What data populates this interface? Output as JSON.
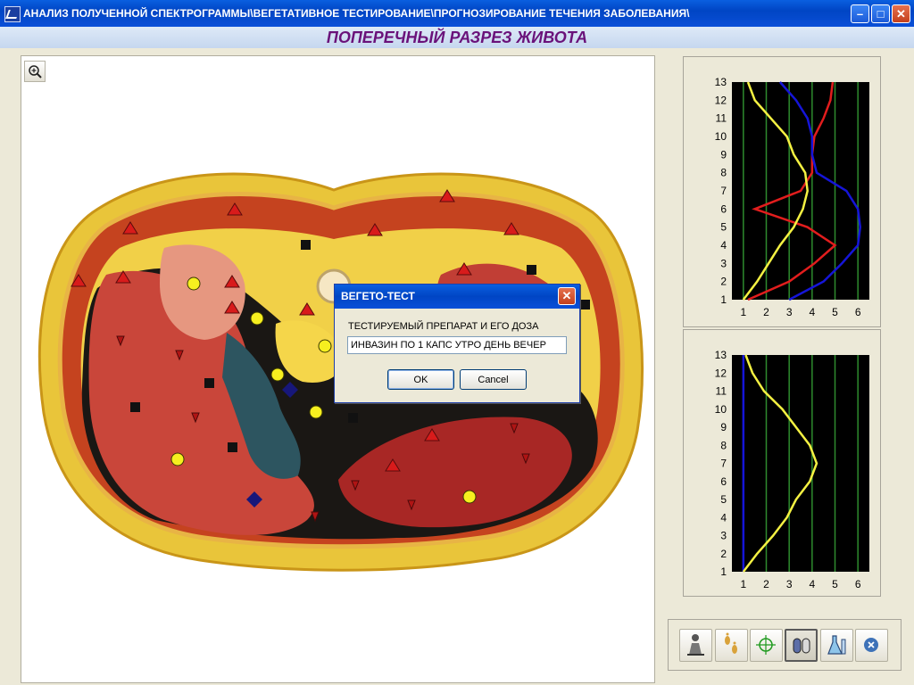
{
  "window": {
    "title": "АНАЛИЗ ПОЛУЧЕННОЙ СПЕКТРОГРАММЫ\\ВЕГЕТАТИВНОЕ ТЕСТИРОВАНИЕ\\ПРОГНОЗИРОВАНИЕ ТЕЧЕНИЯ ЗАБОЛЕВАНИЯ\\",
    "minimize_label": "–",
    "maximize_label": "□",
    "close_label": "✕"
  },
  "header": {
    "title": "ПОПЕРЕЧНЫЙ РАЗРЕЗ ЖИВОТА"
  },
  "main": {
    "zoom_icon": "zoom-in-icon"
  },
  "dialog": {
    "title": "ВЕГЕТО-ТЕСТ",
    "close_label": "✕",
    "prompt": "ТЕСТИРУЕМЫЙ ПРЕПАРАТ И ЕГО ДОЗА",
    "input_value": "ИНВАЗИН ПО 1 КАПС УТРО ДЕНЬ ВЕЧЕР",
    "ok_label": "OK",
    "cancel_label": "Cancel"
  },
  "toolbar": {
    "icons": [
      "patient-icon",
      "footprints-icon",
      "target-icon",
      "capsule-icon",
      "flask-icon",
      "close-circle-icon"
    ],
    "active_index": 3
  },
  "colors": {
    "plot_bg": "#000000",
    "grid": "#2e8b2e",
    "series_red": "#e21d1d",
    "series_blue": "#1515d8",
    "series_yellow": "#f4f142",
    "title_purple": "#6a127a"
  },
  "chart_data": [
    {
      "type": "line",
      "orientation": "vertical",
      "x_ticks": [
        1,
        2,
        3,
        4,
        5,
        6
      ],
      "y_ticks": [
        1,
        2,
        3,
        4,
        5,
        6,
        7,
        8,
        9,
        10,
        11,
        12,
        13
      ],
      "xlim": [
        0.5,
        6.5
      ],
      "ylim": [
        1,
        13
      ],
      "series": [
        {
          "color": "#e21d1d",
          "x": [
            1.2,
            3.0,
            4.1,
            5.0,
            3.8,
            1.5,
            3.5,
            4.0,
            4.0,
            4.1,
            4.5,
            4.8,
            4.9
          ],
          "y": [
            1,
            2,
            3,
            4,
            5,
            6,
            7,
            8,
            9,
            10,
            11,
            12,
            13
          ]
        },
        {
          "color": "#1515d8",
          "x": [
            3.0,
            4.5,
            5.3,
            6.0,
            6.1,
            6.0,
            5.5,
            4.2,
            4.0,
            4.0,
            3.8,
            3.3,
            2.6
          ],
          "y": [
            1,
            2,
            3,
            4,
            5,
            6,
            7,
            8,
            9,
            10,
            11,
            12,
            13
          ]
        },
        {
          "color": "#f4f142",
          "x": [
            1.0,
            1.6,
            2.1,
            2.6,
            3.2,
            3.6,
            3.8,
            3.7,
            3.2,
            2.9,
            2.2,
            1.5,
            1.2
          ],
          "y": [
            1,
            2,
            3,
            4,
            5,
            6,
            7,
            8,
            9,
            10,
            11,
            12,
            13
          ]
        }
      ]
    },
    {
      "type": "line",
      "orientation": "vertical",
      "x_ticks": [
        1,
        2,
        3,
        4,
        5,
        6
      ],
      "y_ticks": [
        1,
        2,
        3,
        4,
        5,
        6,
        7,
        8,
        9,
        10,
        11,
        12,
        13
      ],
      "xlim": [
        0.5,
        6.5
      ],
      "ylim": [
        1,
        13
      ],
      "series": [
        {
          "color": "#1515d8",
          "x": [
            1.0,
            1.0,
            1.0,
            1.0,
            1.0,
            1.0,
            1.0,
            1.0,
            1.0,
            1.0,
            1.0,
            1.0,
            1.0
          ],
          "y": [
            1,
            2,
            3,
            4,
            5,
            6,
            7,
            8,
            9,
            10,
            11,
            12,
            13
          ]
        },
        {
          "color": "#f4f142",
          "x": [
            1.0,
            1.6,
            2.3,
            2.9,
            3.3,
            3.9,
            4.2,
            3.9,
            3.3,
            2.7,
            1.9,
            1.4,
            1.1
          ],
          "y": [
            1,
            2,
            3,
            4,
            5,
            6,
            7,
            8,
            9,
            10,
            11,
            12,
            13
          ]
        }
      ]
    }
  ]
}
